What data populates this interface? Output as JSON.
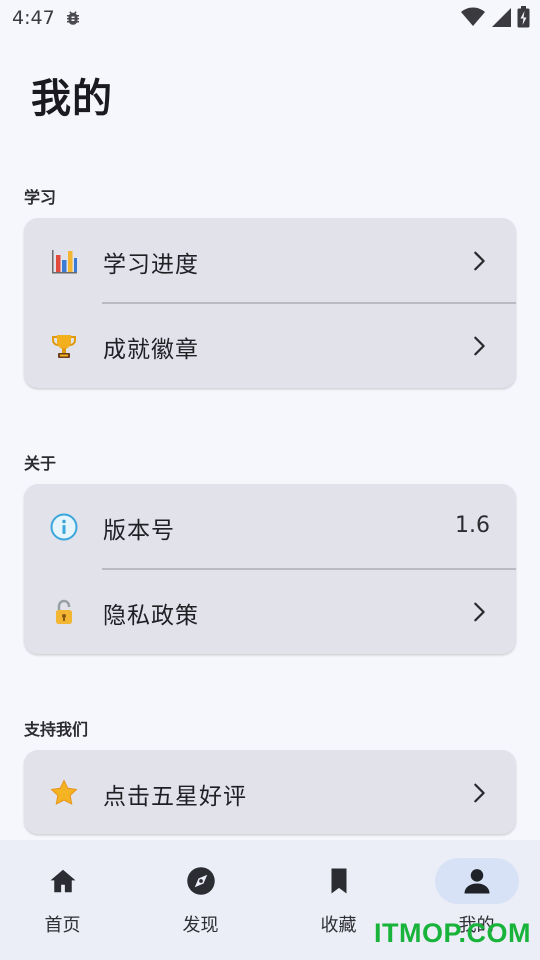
{
  "status_bar": {
    "time": "4:47"
  },
  "page": {
    "title": "我的"
  },
  "sections": {
    "study": {
      "header": "学习",
      "items": [
        {
          "label": "学习进度",
          "icon": "bar-chart-icon"
        },
        {
          "label": "成就徽章",
          "icon": "trophy-icon"
        }
      ]
    },
    "about": {
      "header": "关于",
      "items": [
        {
          "label": "版本号",
          "icon": "info-icon",
          "value": "1.6"
        },
        {
          "label": "隐私政策",
          "icon": "lock-icon"
        }
      ]
    },
    "support": {
      "header": "支持我们",
      "items": [
        {
          "label": "点击五星好评",
          "icon": "star-icon"
        }
      ]
    }
  },
  "bottom_nav": {
    "items": [
      {
        "label": "首页",
        "icon": "home-icon"
      },
      {
        "label": "发现",
        "icon": "compass-icon"
      },
      {
        "label": "收藏",
        "icon": "bookmark-icon"
      },
      {
        "label": "我的",
        "icon": "person-icon",
        "active": true
      }
    ]
  },
  "watermark": "ITMOP.COM",
  "colors": {
    "background": "#f6f7fc",
    "card": "#e1e2ea",
    "nav_background": "#eceef7",
    "active_pill": "#d7e2f6",
    "watermark": "#17b33a"
  }
}
